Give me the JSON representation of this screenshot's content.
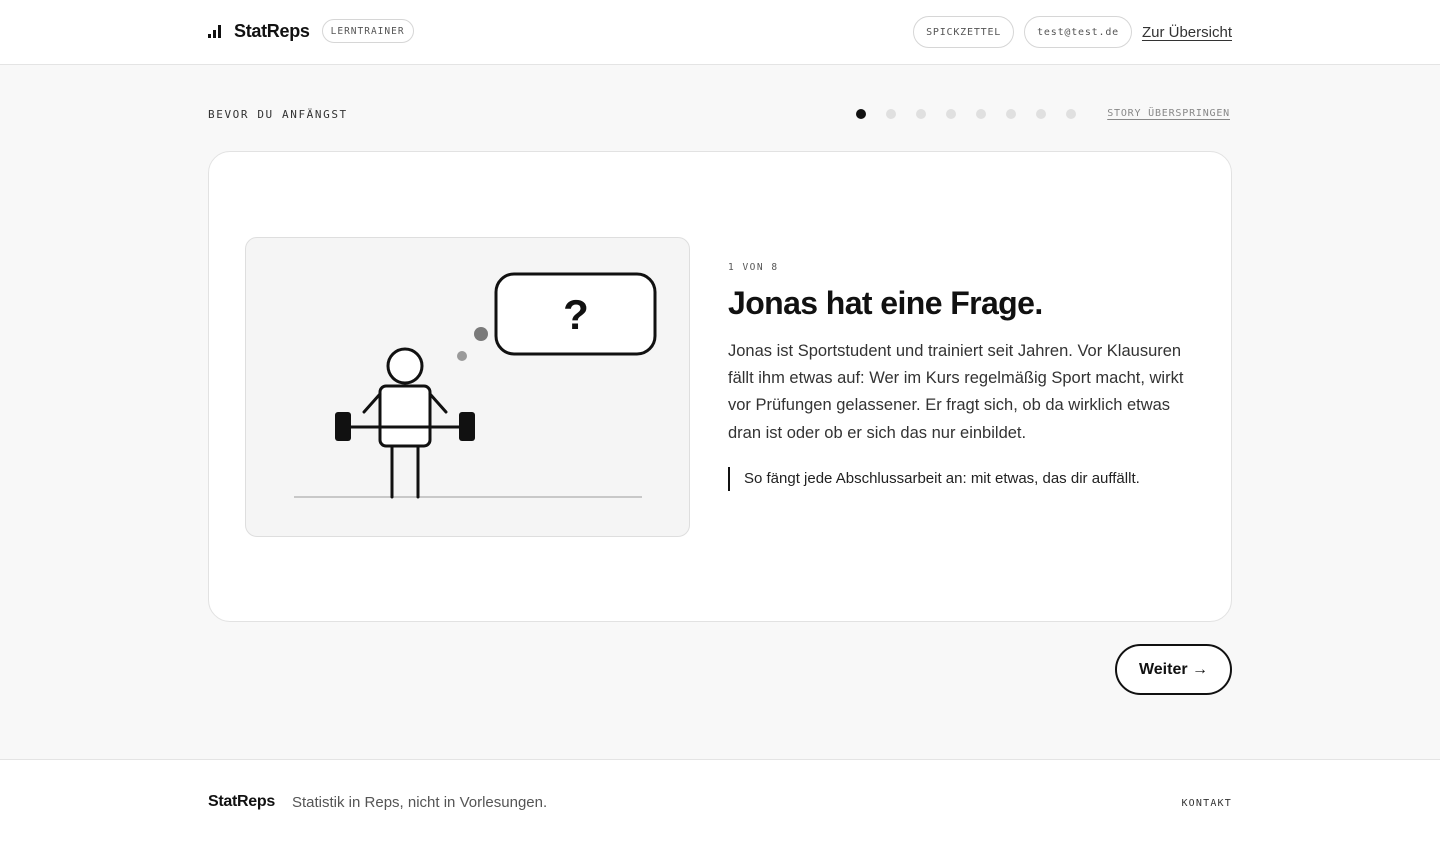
{
  "header": {
    "brand": "StatReps",
    "badge": "LERNTRAINER",
    "cheatsheet": "SPICKZETTEL",
    "user_email": "test@test.de",
    "overview_link": "Zur Übersicht"
  },
  "story": {
    "eyebrow": "BEVOR DU ANFÄNGST",
    "skip_label": "STORY ÜBERSPRINGEN",
    "total_steps": 8,
    "current_step": 1
  },
  "card": {
    "step_label": "1 VON 8",
    "title": "Jonas hat eine Frage.",
    "body": "Jonas ist Sportstudent und trainiert seit Jahren. Vor Klausuren fällt ihm etwas auf: Wer im Kurs regelmäßig Sport macht, wirkt vor Prüfungen gelassener. Er fragt sich, ob da wirklich etwas dran ist oder ob er sich das nur einbildet.",
    "quote": "So fängt jede Abschlussarbeit an: mit etwas, das dir auffällt.",
    "illustration_symbol": "?"
  },
  "navigation": {
    "next_label": "Weiter →"
  },
  "footer": {
    "brand": "StatReps",
    "tagline": "Statistik in Reps, nicht in Vorlesungen.",
    "contact": "KONTAKT"
  },
  "icons": {
    "logo": "bar-chart-icon"
  },
  "colors": {
    "primary": "#111111",
    "dot_inactive": "#e0e0e0",
    "background": "#f8f8f8"
  }
}
